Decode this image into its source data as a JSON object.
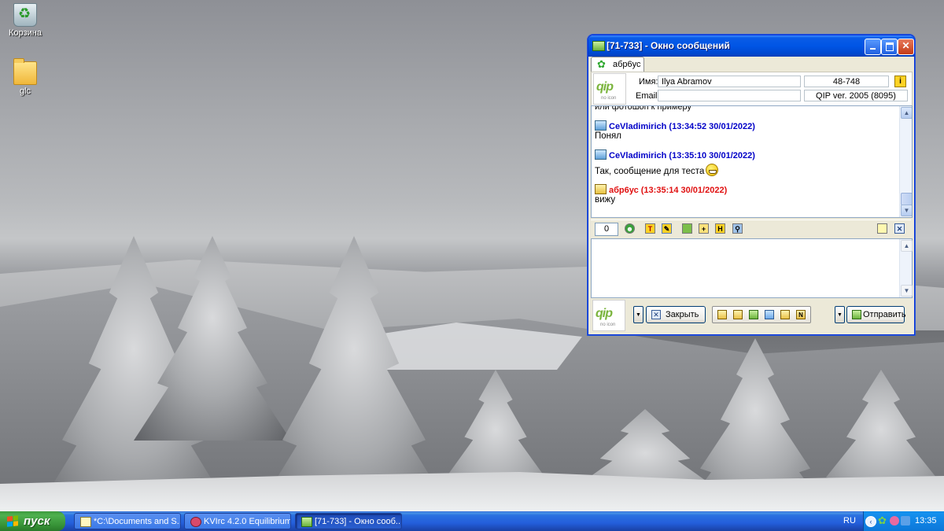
{
  "desktop": {
    "icons": [
      {
        "label": "Корзина"
      },
      {
        "label": "glc"
      }
    ]
  },
  "window": {
    "title": "[71-733] - Окно сообщений",
    "tab_label": "абр6ус",
    "info": {
      "name_label": "Имя:",
      "name_value": "Ilya  Abramov",
      "email_label": "Email:",
      "email_value": "",
      "uin": "48-748",
      "client": "QIP ver. 2005 (8095)",
      "logo_text": "qip",
      "logo_subtext": "no icon"
    },
    "history": {
      "cut_line": "или фотошоп к примеру",
      "messages": [
        {
          "sender": "CeVladimirich (13:34:52 30/01/2022)",
          "text": "Понял",
          "direction": "out"
        },
        {
          "sender": "CeVladimirich (13:35:10 30/01/2022)",
          "text": "Так, сообщение для теста",
          "direction": "out",
          "emoji": "grin-smiley"
        },
        {
          "sender": "абр6ус (13:35:14 30/01/2022)",
          "text": "вижу",
          "direction": "in"
        }
      ]
    },
    "toolbar": {
      "counter": "0",
      "icons": [
        "smiley-icon",
        "text-format-icon",
        "paint-icon",
        "save-icon",
        "add-contact-icon",
        "history-icon",
        "find-icon"
      ],
      "right_icons": [
        "note-icon",
        "clear-icon"
      ]
    },
    "input_value": "",
    "bottom": {
      "logo_text": "qip",
      "logo_subtext": "no icon",
      "close_label": "Закрыть",
      "send_label": "Отправить",
      "icon_bar": [
        "status-icon",
        "contact-card-icon",
        "book-icon",
        "users-icon",
        "file-icon",
        "note-n-icon"
      ]
    }
  },
  "taskbar": {
    "start_label": "пуск",
    "tasks": [
      {
        "label": "*C:\\Documents and S...",
        "active": false
      },
      {
        "label": "KVIrc 4.2.0 Equilibrium",
        "active": false
      },
      {
        "label": "[71-733] - Окно сооб...",
        "active": true
      }
    ],
    "language": "RU",
    "clock": "13:35"
  },
  "colors": {
    "outgoing_sender": "#0000c8",
    "incoming_sender": "#e01010",
    "titlebar": "#0055e5",
    "taskbar": "#245edb",
    "start_button": "#3c9a3c"
  }
}
